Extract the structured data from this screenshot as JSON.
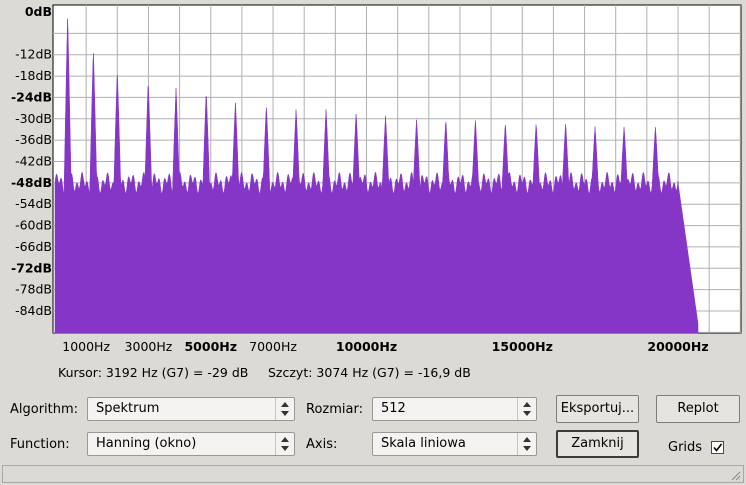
{
  "plot": {
    "y_ticks": [
      {
        "label": "0dB",
        "db": 0,
        "bold": true
      },
      {
        "label": "-12dB",
        "db": -12,
        "bold": false
      },
      {
        "label": "-18dB",
        "db": -18,
        "bold": false
      },
      {
        "label": "-24dB",
        "db": -24,
        "bold": true
      },
      {
        "label": "-30dB",
        "db": -30,
        "bold": false
      },
      {
        "label": "-36dB",
        "db": -36,
        "bold": false
      },
      {
        "label": "-42dB",
        "db": -42,
        "bold": false
      },
      {
        "label": "-48dB",
        "db": -48,
        "bold": true
      },
      {
        "label": "-54dB",
        "db": -54,
        "bold": false
      },
      {
        "label": "-60dB",
        "db": -60,
        "bold": false
      },
      {
        "label": "-66dB",
        "db": -66,
        "bold": false
      },
      {
        "label": "-72dB",
        "db": -72,
        "bold": true
      },
      {
        "label": "-78dB",
        "db": -78,
        "bold": false
      },
      {
        "label": "-84dB",
        "db": -84,
        "bold": false
      }
    ],
    "x_ticks": [
      {
        "label": "1000Hz",
        "hz": 1000,
        "bold": false
      },
      {
        "label": "3000Hz",
        "hz": 3000,
        "bold": false
      },
      {
        "label": "5000Hz",
        "hz": 5000,
        "bold": true
      },
      {
        "label": "7000Hz",
        "hz": 7000,
        "bold": false
      },
      {
        "label": "10000Hz",
        "hz": 10000,
        "bold": true
      },
      {
        "label": "15000Hz",
        "hz": 15000,
        "bold": true
      },
      {
        "label": "20000Hz",
        "hz": 20000,
        "bold": true
      }
    ],
    "fill_color": "#8536c6",
    "grid_color": "#b0b0b0",
    "background": "#ffffff"
  },
  "chart_data": {
    "type": "area",
    "x_unit": "Hz",
    "y_unit": "dB",
    "xlim": [
      0,
      22050
    ],
    "ylim": [
      -90,
      0
    ],
    "grid": true,
    "harmonics_hz": [
      406,
      1231,
      2000,
      2993,
      3886,
      4855,
      5792,
      6785,
      7739,
      8702,
      9667,
      10611,
      11607,
      12546,
      13496,
      14457,
      15446,
      16392,
      17337,
      18269,
      19275,
      20209
    ],
    "harmonics_db": [
      0,
      -10,
      -16,
      -19,
      -21,
      -22,
      -25,
      -26,
      -27,
      -27,
      -28,
      -29,
      -30,
      -30,
      -30,
      -31,
      -31,
      -31,
      -32,
      -32,
      -32,
      -32
    ],
    "floor_db": -48,
    "cutoff_hz": 20650
  },
  "status": {
    "cursor": "Kursor: 3192 Hz (G7) = -29 dB",
    "peak": "Szczyt: 3074 Hz (G7) = -16,9 dB"
  },
  "controls": {
    "algorithm_label": "Algorithm:",
    "algorithm_value": "Spektrum",
    "size_label": "Rozmiar:",
    "size_value": "512",
    "export_label": "Eksportuj...",
    "replot_label": "Replot",
    "function_label": "Function:",
    "function_value": "Hanning (okno)",
    "axis_label": "Axis:",
    "axis_value": "Skala liniowa",
    "close_label": "Zamknij",
    "grids_label": "Grids",
    "grids_checked": true
  }
}
